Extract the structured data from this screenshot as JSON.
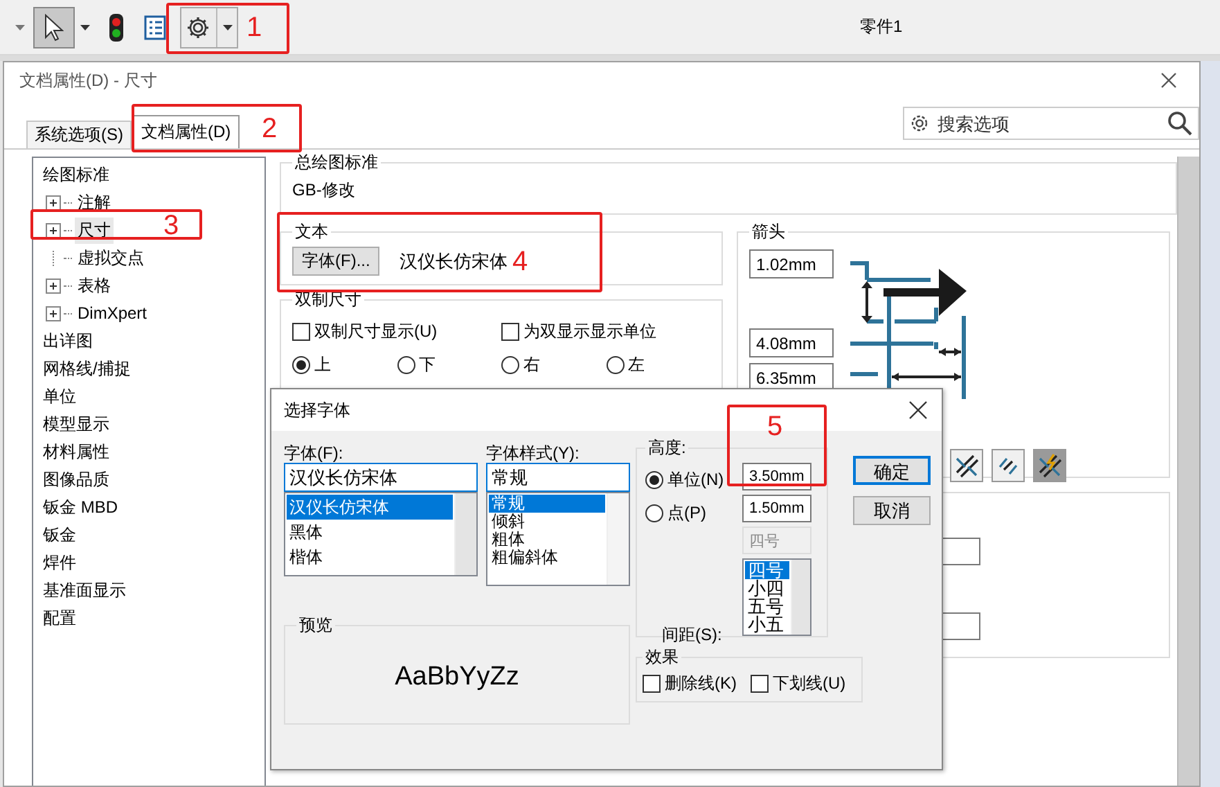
{
  "toolbar": {
    "document_title": "零件1"
  },
  "dialog": {
    "title": "文档属性(D) - 尺寸",
    "tabs": [
      {
        "label": "系统选项(S)",
        "selected": false
      },
      {
        "label": "文档属性(D)",
        "selected": true
      }
    ],
    "search": {
      "placeholder": "搜索选项"
    },
    "tree": [
      {
        "label": "绘图标准",
        "selected": false,
        "children": [
          {
            "label": "注解",
            "expandable": true,
            "selected": false
          },
          {
            "label": "尺寸",
            "expandable": true,
            "selected": true
          },
          {
            "label": "虚拟交点",
            "expandable": false,
            "selected": false
          },
          {
            "label": "表格",
            "expandable": true,
            "selected": false
          },
          {
            "label": "DimXpert",
            "expandable": true,
            "selected": false
          }
        ]
      },
      {
        "label": "出详图",
        "selected": false
      },
      {
        "label": "网格线/捕捉",
        "selected": false
      },
      {
        "label": "单位",
        "selected": false
      },
      {
        "label": "模型显示",
        "selected": false
      },
      {
        "label": "材料属性",
        "selected": false
      },
      {
        "label": "图像品质",
        "selected": false
      },
      {
        "label": "钣金 MBD",
        "selected": false
      },
      {
        "label": "钣金",
        "selected": false
      },
      {
        "label": "焊件",
        "selected": false
      },
      {
        "label": "基准面显示",
        "selected": false
      },
      {
        "label": "配置",
        "selected": false
      }
    ],
    "overall_standard": {
      "title": "总绘图标准",
      "value": "GB-修改"
    },
    "text_group": {
      "title": "文本",
      "font_button": "字体(F)...",
      "font_name": "汉仪长仿宋体"
    },
    "dual_group": {
      "title": "双制尺寸",
      "checks": [
        {
          "label": "双制尺寸显示(U)",
          "checked": false
        },
        {
          "label": "为双显示显示单位",
          "checked": false
        }
      ],
      "positions": [
        {
          "label": "上",
          "selected": true
        },
        {
          "label": "下",
          "selected": false
        },
        {
          "label": "右",
          "selected": false
        },
        {
          "label": "左",
          "selected": false
        }
      ]
    },
    "arrows_group": {
      "title": "箭头",
      "fields": [
        "1.02mm",
        "4.08mm",
        "6.35mm"
      ],
      "style_buttons": [
        {
          "selected": false
        },
        {
          "selected": false
        },
        {
          "selected": true
        }
      ]
    }
  },
  "font_dialog": {
    "title": "选择字体",
    "font": {
      "label": "字体(F):",
      "value": "汉仪长仿宋体",
      "options": [
        {
          "label": "汉仪长仿宋体",
          "selected": true
        },
        {
          "label": "黑体",
          "selected": false
        },
        {
          "label": "楷体",
          "selected": false
        }
      ]
    },
    "style": {
      "label": "字体样式(Y):",
      "value": "常规",
      "options": [
        {
          "label": "常规",
          "selected": true
        },
        {
          "label": "倾斜",
          "selected": false
        },
        {
          "label": "粗体",
          "selected": false
        },
        {
          "label": "粗偏斜体",
          "selected": false
        }
      ]
    },
    "height": {
      "title": "高度:",
      "modes": [
        {
          "label": "单位(N)",
          "selected": true,
          "value": "3.50mm"
        },
        {
          "label": "点(P)",
          "selected": false,
          "value": "1.50mm"
        }
      ],
      "size_value": "四号",
      "size_options": [
        {
          "label": "四号",
          "selected": true
        },
        {
          "label": "小四",
          "selected": false
        },
        {
          "label": "五号",
          "selected": false
        },
        {
          "label": "小五",
          "selected": false
        }
      ],
      "spacing_label": "间距(S):"
    },
    "buttons": [
      {
        "label": "确定",
        "default": true
      },
      {
        "label": "取消",
        "default": false
      }
    ],
    "preview": {
      "title": "预览",
      "sample": "AaBbYyZz"
    },
    "effects": {
      "title": "效果",
      "options": [
        {
          "label": "删除线(K)",
          "checked": false
        },
        {
          "label": "下划线(U)",
          "checked": false
        }
      ]
    }
  },
  "annotations": [
    {
      "label": "1"
    },
    {
      "label": "2"
    },
    {
      "label": "3"
    },
    {
      "label": "4"
    },
    {
      "label": "5"
    }
  ]
}
